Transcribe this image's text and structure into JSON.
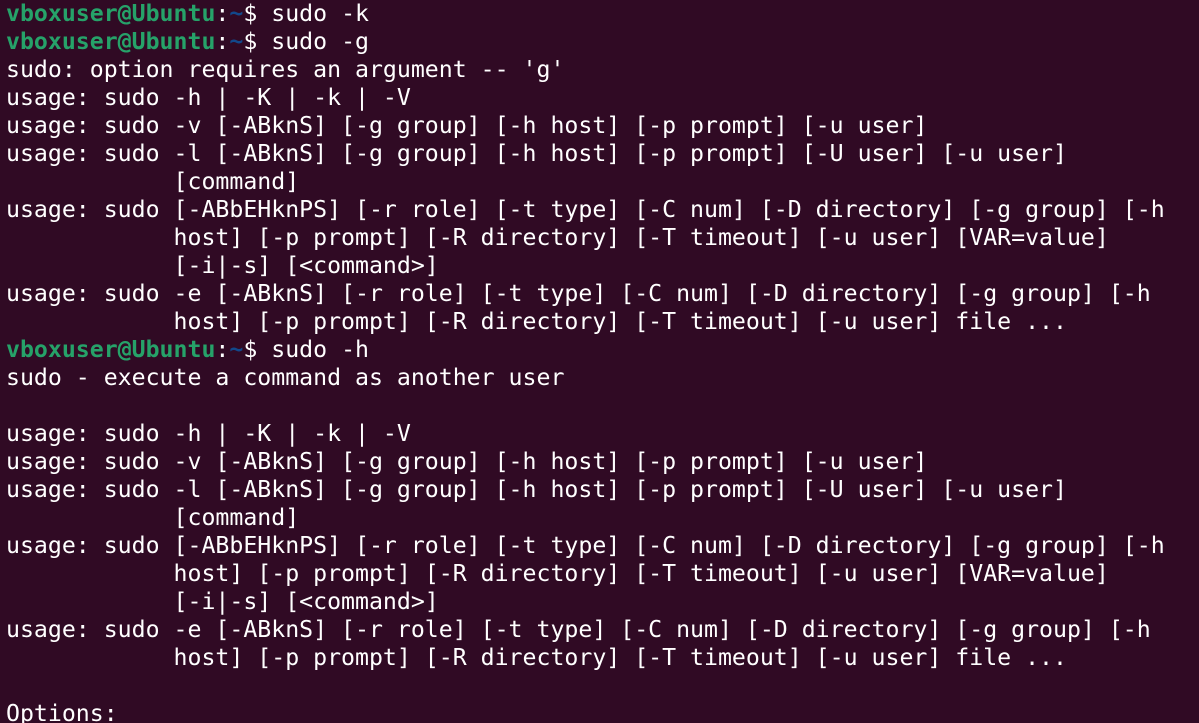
{
  "terminal": {
    "colors": {
      "background": "#300a24",
      "text": "#ffffff",
      "prompt_user": "#26a269",
      "prompt_path": "#12488b"
    },
    "lines": [
      {
        "type": "prompt",
        "user": "vboxuser@Ubuntu",
        "sep": ":",
        "path": "~",
        "symbol": "$ ",
        "cmd": "sudo -k"
      },
      {
        "type": "prompt",
        "user": "vboxuser@Ubuntu",
        "sep": ":",
        "path": "~",
        "symbol": "$ ",
        "cmd": "sudo -g"
      },
      {
        "type": "output",
        "text": "sudo: option requires an argument -- 'g'"
      },
      {
        "type": "output",
        "text": "usage: sudo -h | -K | -k | -V"
      },
      {
        "type": "output",
        "text": "usage: sudo -v [-ABknS] [-g group] [-h host] [-p prompt] [-u user]"
      },
      {
        "type": "output",
        "text": "usage: sudo -l [-ABknS] [-g group] [-h host] [-p prompt] [-U user] [-u user]"
      },
      {
        "type": "output",
        "text": "            [command]"
      },
      {
        "type": "output",
        "text": "usage: sudo [-ABbEHknPS] [-r role] [-t type] [-C num] [-D directory] [-g group] [-h"
      },
      {
        "type": "output",
        "text": "            host] [-p prompt] [-R directory] [-T timeout] [-u user] [VAR=value]"
      },
      {
        "type": "output",
        "text": "            [-i|-s] [<command>]"
      },
      {
        "type": "output",
        "text": "usage: sudo -e [-ABknS] [-r role] [-t type] [-C num] [-D directory] [-g group] [-h"
      },
      {
        "type": "output",
        "text": "            host] [-p prompt] [-R directory] [-T timeout] [-u user] file ..."
      },
      {
        "type": "prompt",
        "user": "vboxuser@Ubuntu",
        "sep": ":",
        "path": "~",
        "symbol": "$ ",
        "cmd": "sudo -h"
      },
      {
        "type": "output",
        "text": "sudo - execute a command as another user"
      },
      {
        "type": "output",
        "text": ""
      },
      {
        "type": "output",
        "text": "usage: sudo -h | -K | -k | -V"
      },
      {
        "type": "output",
        "text": "usage: sudo -v [-ABknS] [-g group] [-h host] [-p prompt] [-u user]"
      },
      {
        "type": "output",
        "text": "usage: sudo -l [-ABknS] [-g group] [-h host] [-p prompt] [-U user] [-u user]"
      },
      {
        "type": "output",
        "text": "            [command]"
      },
      {
        "type": "output",
        "text": "usage: sudo [-ABbEHknPS] [-r role] [-t type] [-C num] [-D directory] [-g group] [-h"
      },
      {
        "type": "output",
        "text": "            host] [-p prompt] [-R directory] [-T timeout] [-u user] [VAR=value]"
      },
      {
        "type": "output",
        "text": "            [-i|-s] [<command>]"
      },
      {
        "type": "output",
        "text": "usage: sudo -e [-ABknS] [-r role] [-t type] [-C num] [-D directory] [-g group] [-h"
      },
      {
        "type": "output",
        "text": "            host] [-p prompt] [-R directory] [-T timeout] [-u user] file ..."
      },
      {
        "type": "output",
        "text": ""
      },
      {
        "type": "output",
        "text": "Options:"
      }
    ]
  }
}
